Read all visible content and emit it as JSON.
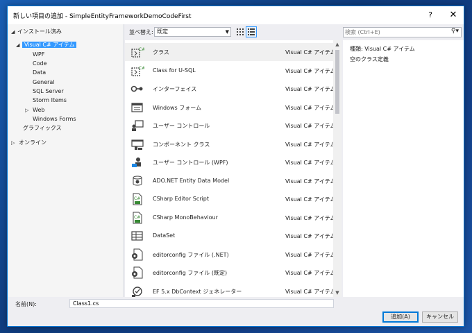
{
  "window": {
    "title": "新しい項目の追加 - SimpleEntityFrameworkDemoCodeFirst",
    "help": "?",
    "close": "✕"
  },
  "tree": {
    "installed": "インストール済み",
    "items": [
      "Visual C# アイテム",
      "WPF",
      "Code",
      "Data",
      "General",
      "SQL Server",
      "Storm Items",
      "Web",
      "Windows Forms",
      "グラフィックス"
    ],
    "online": "オンライン"
  },
  "toolbar": {
    "sort_label": "並べ替え:",
    "sort_value": "既定",
    "search_placeholder": "検索 (Ctrl+E)"
  },
  "templates": [
    {
      "name": "クラス",
      "lang": "Visual C# アイテム",
      "icon": "class-icon"
    },
    {
      "name": "Class for U-SQL",
      "lang": "Visual C# アイテム",
      "icon": "class-icon"
    },
    {
      "name": "インターフェイス",
      "lang": "Visual C# アイテム",
      "icon": "interface-icon"
    },
    {
      "name": "Windows フォーム",
      "lang": "Visual C# アイテム",
      "icon": "form-icon"
    },
    {
      "name": "ユーザー コントロール",
      "lang": "Visual C# アイテム",
      "icon": "user-control-icon"
    },
    {
      "name": "コンポーネント クラス",
      "lang": "Visual C# アイテム",
      "icon": "component-icon"
    },
    {
      "name": "ユーザー コントロール (WPF)",
      "lang": "Visual C# アイテム",
      "icon": "wpf-user-control-icon"
    },
    {
      "name": "ADO.NET Entity Data Model",
      "lang": "Visual C# アイテム",
      "icon": "entity-model-icon"
    },
    {
      "name": "CSharp Editor Script",
      "lang": "Visual C# アイテム",
      "icon": "csharp-file-icon"
    },
    {
      "name": "CSharp MonoBehaviour",
      "lang": "Visual C# アイテム",
      "icon": "csharp-file-icon"
    },
    {
      "name": "DataSet",
      "lang": "Visual C# アイテム",
      "icon": "dataset-icon"
    },
    {
      "name": "editorconfig ファイル (.NET)",
      "lang": "Visual C# アイテム",
      "icon": "config-icon"
    },
    {
      "name": "editorconfig ファイル (既定)",
      "lang": "Visual C# アイテム",
      "icon": "config-icon"
    },
    {
      "name": "EF 5.x DbContext ジェネレーター",
      "lang": "Visual C# アイテム",
      "icon": "generator-icon"
    }
  ],
  "details": {
    "type_label": "種類:",
    "type_value": "Visual C# アイテム",
    "description": "空のクラス定義"
  },
  "footer": {
    "name_label": "名前(N):",
    "name_value": "Class1.cs",
    "add_button": "追加(A)",
    "cancel_button": "キャンセル"
  },
  "colors": {
    "selection": "#3399ff",
    "accent": "#0078d7"
  }
}
